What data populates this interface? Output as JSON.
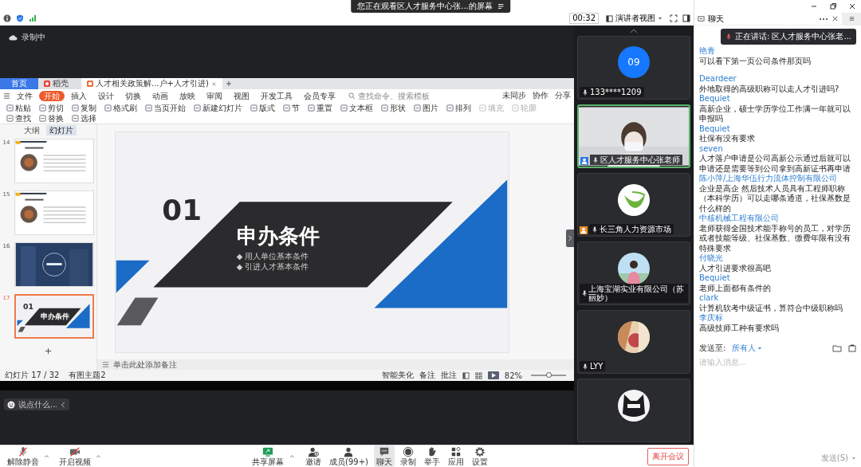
{
  "share_banner": {
    "text": "您正在观看区人才服务中心张...的屏幕"
  },
  "meeting_bar": {
    "timer": "00:32",
    "view_button": "演讲者视图"
  },
  "stage": {
    "recording": "录制中",
    "comment_field": {
      "placeholder": "说点什么..."
    }
  },
  "shared_window": {
    "doc_tabs": [
      {
        "label": "首页",
        "kind": "home",
        "selected": false
      },
      {
        "label": "稻壳",
        "kind": "app",
        "selected": false
      },
      {
        "label": "人才相关政策解...户+人才引进)",
        "kind": "document",
        "selected": true
      }
    ],
    "ribbon_tabs": [
      {
        "label": "文件",
        "selected": false
      },
      {
        "label": "开始",
        "selected": true
      },
      {
        "label": "插入",
        "selected": false
      },
      {
        "label": "设计",
        "selected": false
      },
      {
        "label": "切换",
        "selected": false
      },
      {
        "label": "动画",
        "selected": false
      },
      {
        "label": "放映",
        "selected": false
      },
      {
        "label": "审阅",
        "selected": false
      },
      {
        "label": "视图",
        "selected": false
      },
      {
        "label": "开发工具",
        "selected": false
      },
      {
        "label": "会员专享",
        "selected": false
      }
    ],
    "command_search": {
      "placeholder": "查找命令、搜索模板"
    },
    "ribbon_actions": [
      "未同步",
      "协作",
      "分享"
    ],
    "ribbon_tools": [
      {
        "label": "粘贴",
        "disabled": false
      },
      {
        "label": "剪切",
        "disabled": false
      },
      {
        "label": "复制",
        "disabled": false
      },
      {
        "label": "格式刷",
        "disabled": false
      },
      {
        "label": "当页开始",
        "disabled": false
      },
      {
        "label": "新建幻灯片",
        "disabled": false
      },
      {
        "label": "版式",
        "disabled": false
      },
      {
        "label": "节",
        "disabled": false
      },
      {
        "label": "重置",
        "disabled": false
      },
      {
        "label": "文本框",
        "disabled": false
      },
      {
        "label": "形状",
        "disabled": false
      },
      {
        "label": "图片",
        "disabled": false
      },
      {
        "label": "排列",
        "disabled": false
      },
      {
        "label": "填充",
        "disabled": true
      },
      {
        "label": "轮廓",
        "disabled": true
      },
      {
        "label": "查找",
        "disabled": false
      },
      {
        "label": "替换",
        "disabled": false
      },
      {
        "label": "选择",
        "disabled": false
      }
    ],
    "panel_tabs": [
      {
        "label": "大纲",
        "selected": false
      },
      {
        "label": "幻灯片",
        "selected": true
      }
    ],
    "thumbnails": [
      {
        "number": "14",
        "kind": "text-slide",
        "selected": false
      },
      {
        "number": "15",
        "kind": "text-slide",
        "selected": false
      },
      {
        "number": "16",
        "kind": "cover",
        "selected": false
      },
      {
        "number": "17",
        "kind": "section",
        "selected": true,
        "heading": "01",
        "title": "申办条件"
      }
    ],
    "slide": {
      "number": "01",
      "title": "申办条件",
      "bullets": [
        "◆ 用人单位基本条件",
        "◆ 引进人才基本条件"
      ]
    },
    "notes": {
      "placeholder": "单击此处添加备注"
    },
    "status": {
      "slide_count": "幻灯片 17 / 32",
      "theme": "有图主题2",
      "beautify": "智能美化",
      "notes_button": "备注",
      "comments_button": "批注",
      "zoom": "82%",
      "zoom_slider": {
        "level": 0.5
      }
    }
  },
  "participants": [
    {
      "name": "133****1209",
      "kind": "number",
      "avatar_text": "09",
      "selected": false
    },
    {
      "name": "区人才服务中心张老师",
      "kind": "camera",
      "selected": true,
      "badge": true,
      "color": "#2d7be5"
    },
    {
      "name": "长三角人力资源市场",
      "kind": "logo",
      "selected": false,
      "badge": true,
      "color": "#f08a24"
    },
    {
      "name": "上海宝湖实业有限公司（苏丽妙）",
      "selected": false
    },
    {
      "name": "LYY",
      "selected": false
    },
    {
      "kind": "dark-avatar",
      "selected": false
    }
  ],
  "toolbar": [
    {
      "label": "解除静音",
      "has_menu": true,
      "selected": false
    },
    {
      "label": "开启视频",
      "has_menu": true,
      "selected": false
    },
    {
      "label": "共享屏幕",
      "has_menu": true,
      "selected": false
    },
    {
      "label": "邀请",
      "has_menu": false,
      "selected": false
    },
    {
      "label": "成员(99+)",
      "has_menu": false,
      "selected": false
    },
    {
      "label": "聊天",
      "has_menu": false,
      "selected": true
    },
    {
      "label": "录制",
      "has_menu": false,
      "selected": false
    },
    {
      "label": "举手",
      "has_menu": false,
      "selected": false
    },
    {
      "label": "应用",
      "has_menu": false,
      "selected": false
    },
    {
      "label": "设置",
      "has_menu": false,
      "selected": false
    }
  ],
  "leave_button": "离开会议",
  "chat": {
    "title": "聊天",
    "speaking": "正在讲话: 区人才服务中心张老...",
    "messages": [
      {
        "sender": "艳青",
        "text": "可以看下第一页公司条件那页吗"
      },
      {
        "sender": "Deardeer",
        "text": "外地取得的高级职称可以走人才引进吗?"
      },
      {
        "sender": "Bequiet",
        "text": "高新企业，硕士学历学位工作满一年就可以申报吗"
      },
      {
        "sender": "Bequiet",
        "text": "社保有没有要求"
      },
      {
        "sender": "seven",
        "text": "人才落户申请是公司高新公示通过后就可以申请还是需要等到公司拿到高新证书再申请"
      },
      {
        "sender": "陈小萍/上海华伍行力流体控制有限公司",
        "text": "企业是高企  然后技术人员具有工程师职称（本科学历）可以走哪条通道，社保基数是什么样的"
      },
      {
        "sender": "中核机械工程有限公司",
        "text": "老师获得全国技术能手称号的员工，对学历或者技能等级、社保基数、缴费年限有没有特殊要求"
      },
      {
        "sender": "付晓光",
        "text": "人才引进要求很高吧"
      },
      {
        "sender": "Bequiet",
        "text": "老师上面都有条件的"
      },
      {
        "sender": "clark",
        "text": "计算机软考中级证书，算符合中级职称吗"
      },
      {
        "sender": "李庆标",
        "text": "高级技师工种有要求吗"
      }
    ],
    "send_to_label": "发送至:",
    "send_to": "所有人",
    "placeholder": "请输入消息...",
    "send_button": "发送(S)"
  }
}
